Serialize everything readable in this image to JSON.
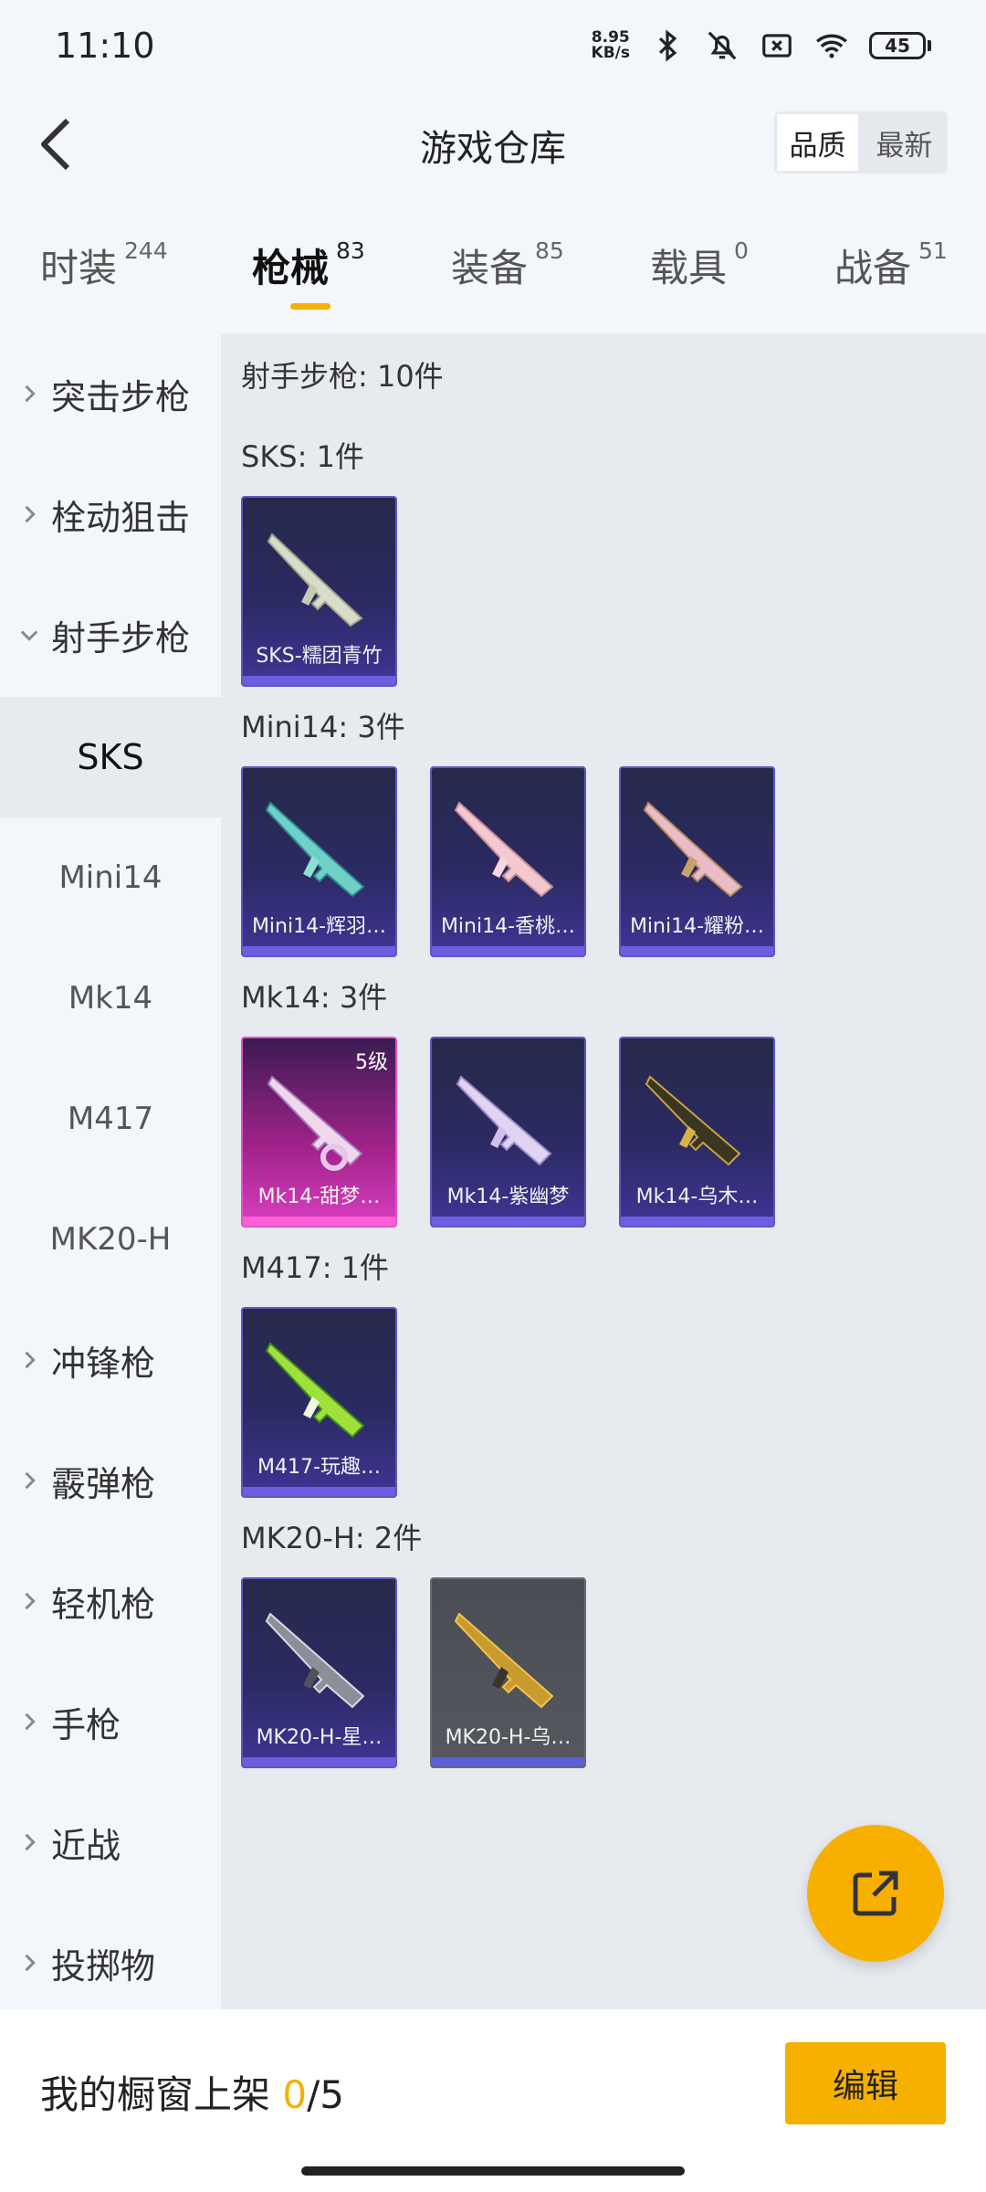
{
  "status": {
    "time": "11:10",
    "net_speed_value": "8.95",
    "net_speed_unit": "KB/s",
    "battery": "45",
    "icons": [
      "bluetooth-icon",
      "bell-muted-icon",
      "sim-off-icon",
      "wifi-icon",
      "battery-icon"
    ]
  },
  "header": {
    "title": "游戏仓库",
    "sort_quality": "品质",
    "sort_latest": "最新",
    "active_sort": "quality"
  },
  "tabs": [
    {
      "label": "时装",
      "count": "244"
    },
    {
      "label": "枪械",
      "count": "83"
    },
    {
      "label": "装备",
      "count": "85"
    },
    {
      "label": "载具",
      "count": "0"
    },
    {
      "label": "战备",
      "count": "51"
    }
  ],
  "active_tab": 1,
  "sidebar": {
    "assault_rifle": "突击步枪",
    "bolt_sniper": "栓动狙击",
    "dmr": "射手步枪",
    "dmr_subs": [
      "SKS",
      "Mini14",
      "Mk14",
      "M417",
      "MK20-H"
    ],
    "smg": "冲锋枪",
    "shotgun": "霰弹枪",
    "lmg": "轻机枪",
    "pistol": "手枪",
    "melee": "近战",
    "throwable": "投掷物"
  },
  "content": {
    "summary": "射手步枪: 10件",
    "groups": [
      {
        "title": "SKS: 1件",
        "items": [
          {
            "name": "SKS-糯团青竹"
          }
        ]
      },
      {
        "title": "Mini14: 3件",
        "items": [
          {
            "name": "Mini14-辉羽…"
          },
          {
            "name": "Mini14-香桃…"
          },
          {
            "name": "Mini14-耀粉…"
          }
        ]
      },
      {
        "title": "Mk14: 3件",
        "items": [
          {
            "name": "Mk14-甜梦…",
            "level": "5级"
          },
          {
            "name": "Mk14-紫幽梦"
          },
          {
            "name": "Mk14-乌木…"
          }
        ]
      },
      {
        "title": "M417: 1件",
        "items": [
          {
            "name": "M417-玩趣…"
          }
        ]
      },
      {
        "title": "MK20-H: 2件",
        "items": [
          {
            "name": "MK20-H-星…"
          },
          {
            "name": "MK20-H-乌…"
          }
        ]
      }
    ]
  },
  "bottom": {
    "showcase_label": "我的橱窗上架",
    "showcase_current": "0",
    "showcase_total": "/5",
    "edit": "编辑"
  },
  "colors": {
    "accent": "#f6b000",
    "card_purple": "#3f3596",
    "card_pink": "#d93fc1",
    "card_grey": "#56585f"
  }
}
